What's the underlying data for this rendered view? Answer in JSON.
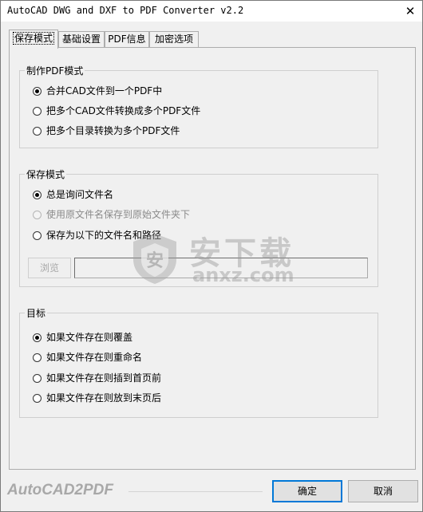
{
  "window": {
    "title": "AutoCAD DWG and DXF to PDF Converter v2.2",
    "close_glyph": "✕"
  },
  "tabs": [
    {
      "label": "保存模式",
      "active": true
    },
    {
      "label": "基础设置",
      "active": false
    },
    {
      "label": "PDF信息",
      "active": false
    },
    {
      "label": "加密选项",
      "active": false
    }
  ],
  "groups": {
    "pdf_mode": {
      "title": "制作PDF模式",
      "options": [
        {
          "label": "合并CAD文件到一个PDF中",
          "checked": true,
          "enabled": true
        },
        {
          "label": "把多个CAD文件转换成多个PDF文件",
          "checked": false,
          "enabled": true
        },
        {
          "label": "把多个目录转换为多个PDF文件",
          "checked": false,
          "enabled": true
        }
      ]
    },
    "save_mode": {
      "title": "保存模式",
      "options": [
        {
          "label": "总是询问文件名",
          "checked": true,
          "enabled": true
        },
        {
          "label": "使用原文件名保存到原始文件夹下",
          "checked": false,
          "enabled": false
        },
        {
          "label": "保存为以下的文件名和路径",
          "checked": false,
          "enabled": true
        }
      ],
      "browse_label": "浏览",
      "path_value": ""
    },
    "target": {
      "title": "目标",
      "options": [
        {
          "label": "如果文件存在则覆盖",
          "checked": true,
          "enabled": true
        },
        {
          "label": "如果文件存在则重命名",
          "checked": false,
          "enabled": true
        },
        {
          "label": "如果文件存在则插到首页前",
          "checked": false,
          "enabled": true
        },
        {
          "label": "如果文件存在则放到末页后",
          "checked": false,
          "enabled": true
        }
      ]
    }
  },
  "watermark": {
    "cn": "安下载",
    "en": "anxz.com"
  },
  "footer": {
    "logo_text": "AutoCAD2PDF",
    "ok_label": "确定",
    "cancel_label": "取消"
  },
  "colors": {
    "accent": "#0078d7",
    "window_bg": "#f0f0f0",
    "disabled_text": "#8a8a8a"
  }
}
